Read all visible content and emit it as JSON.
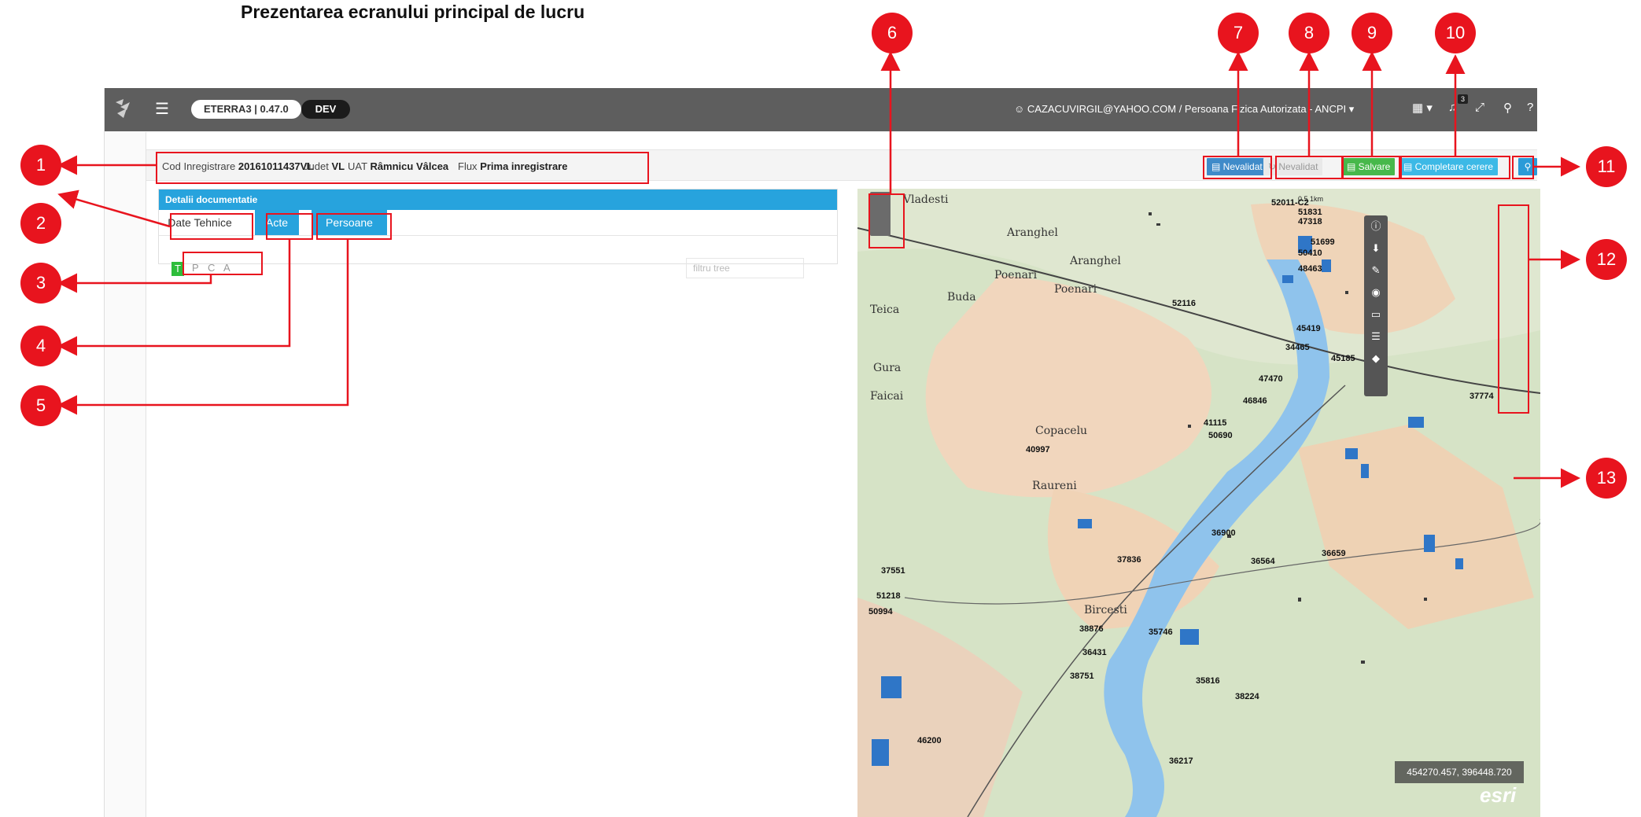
{
  "doc_title": "Prezentarea ecranului principal de lucru",
  "topbar": {
    "version": "ETERRA3 | 0.47.0",
    "env": "DEV",
    "user": "☺ CAZACUVIRGIL@YAHOO.COM / Persoana Fizica Autorizata - ANCPI ▾",
    "notifications": "3",
    "icons": [
      "menu-icon",
      "stack-icon",
      "bell-icon",
      "expand-icon",
      "search-icon",
      "help-icon"
    ]
  },
  "infobar": {
    "cod_label": "Cod Inregistrare",
    "cod_value": "20161011437VL",
    "judet_label": "Judet",
    "judet_value": "VL",
    "uat_label": "UAT",
    "uat_value": "Râmnicu Vâlcea",
    "flux_label": "Flux",
    "flux_value": "Prima inregistrare"
  },
  "buttons": {
    "nevalidat_1": "Nevalidat",
    "nevalidat_2": "Nevalidat",
    "salvare": "Salvare",
    "completare": "Completare cerere"
  },
  "panel": {
    "title": "Detalii documentatie",
    "tabs": [
      "Date Tehnice",
      "Acte",
      "Persoane"
    ],
    "letters": [
      "T",
      "P",
      "C",
      "A"
    ],
    "filter_placeholder": "filtru tree"
  },
  "map": {
    "coords": "454270.457, 396448.720",
    "esri": "esri",
    "scale": "0.5   1km",
    "place_labels": [
      "Vladesti",
      "Aranghel",
      "Poenari",
      "Aranghel",
      "Poenari",
      "Buda",
      "Teica",
      "Gura",
      "Faicai",
      "Copacelu",
      "Raureni",
      "Bircesti"
    ],
    "parcel_numbers": [
      "52011-C2",
      "51831",
      "47318",
      "51699",
      "50410",
      "48463",
      "52116",
      "45419",
      "34465",
      "45185",
      "47470",
      "46846",
      "41115",
      "50690",
      "40997",
      "37774",
      "36900",
      "36659",
      "36564",
      "37836",
      "38876",
      "35746",
      "36431",
      "38751",
      "35816",
      "38224",
      "36217",
      "46200",
      "37551",
      "51218",
      "50994"
    ]
  },
  "callouts": [
    "1",
    "2",
    "3",
    "4",
    "5",
    "6",
    "7",
    "8",
    "9",
    "10",
    "11",
    "12",
    "13"
  ]
}
